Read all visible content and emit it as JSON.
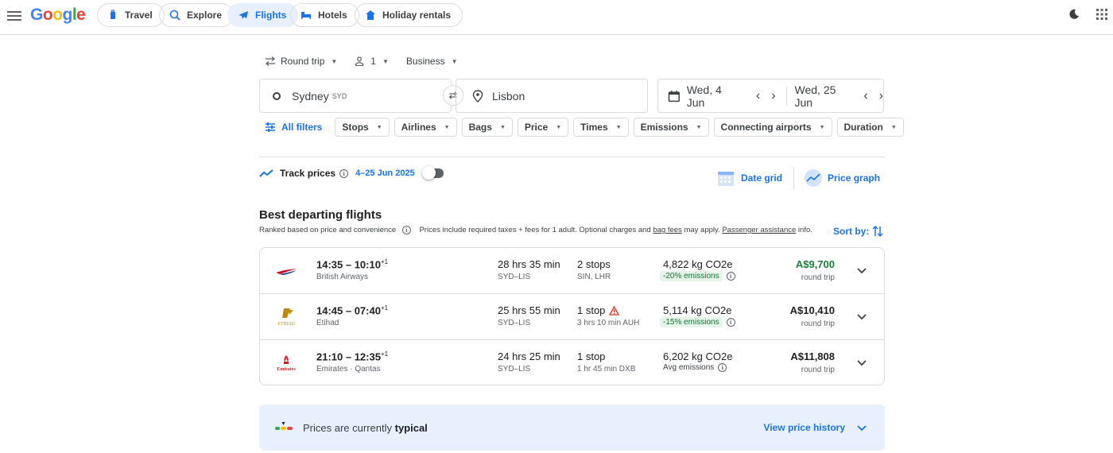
{
  "header": {
    "logo": "Google",
    "nav": [
      {
        "label": "Travel",
        "icon": "luggage-icon"
      },
      {
        "label": "Explore",
        "icon": "explore-icon"
      },
      {
        "label": "Flights",
        "icon": "airplane-icon",
        "active": true
      },
      {
        "label": "Hotels",
        "icon": "bed-icon"
      },
      {
        "label": "Holiday rentals",
        "icon": "house-icon"
      }
    ]
  },
  "search": {
    "trip_type": "Round trip",
    "passengers": "1",
    "cabin": "Business",
    "origin": "Sydney",
    "origin_code": "SYD",
    "destination": "Lisbon",
    "depart_date": "Wed, 4 Jun",
    "return_date": "Wed, 25 Jun"
  },
  "filters": {
    "all_filters": "All filters",
    "chips": [
      "Stops",
      "Airlines",
      "Bags",
      "Price",
      "Times",
      "Emissions",
      "Connecting airports",
      "Duration"
    ]
  },
  "track": {
    "label": "Track prices",
    "range": "4–25 Jun 2025",
    "date_grid": "Date grid",
    "price_graph": "Price graph"
  },
  "results": {
    "title": "Best departing flights",
    "ranked_text": "Ranked based on price and convenience",
    "prices_text_1": "Prices include required taxes + fees for 1 adult. Optional charges and",
    "bag_fees": "bag fees",
    "prices_text_2": "may apply.",
    "passenger_assistance": "Passenger assistance",
    "prices_text_3": "info.",
    "sort_by": "Sort by:",
    "flights": [
      {
        "times": "14:35 – 10:10",
        "plus": "+1",
        "airline": "British Airways",
        "duration": "28 hrs 35 min",
        "route": "SYD–LIS",
        "stops": "2 stops",
        "stop_info": "SIN, LHR",
        "co2": "4,822 kg CO2e",
        "emissions": "-20% emissions",
        "price": "A$9,700",
        "trip": "round trip"
      },
      {
        "times": "14:45 – 07:40",
        "plus": "+1",
        "airline": "Etihad",
        "duration": "25 hrs 55 min",
        "route": "SYD–LIS",
        "stops": "1 stop",
        "stop_info": "3 hrs 10 min AUH",
        "co2": "5,114 kg CO2e",
        "emissions": "-15% emissions",
        "price": "A$10,410",
        "trip": "round trip"
      },
      {
        "times": "21:10 – 12:35",
        "plus": "+1",
        "airline": "Emirates · Qantas",
        "duration": "24 hrs 25 min",
        "route": "SYD–LIS",
        "stops": "1 stop",
        "stop_info": "1 hr 45 min DXB",
        "co2": "6,202 kg CO2e",
        "emissions": "Avg emissions",
        "price": "A$11,808",
        "trip": "round trip"
      }
    ]
  },
  "price_insight": {
    "text": "Prices are currently",
    "level": "typical",
    "link": "View price history"
  },
  "colors": {
    "accent": "#1a73e8",
    "green": "#188038",
    "badge_bg": "#e6f4ea"
  }
}
